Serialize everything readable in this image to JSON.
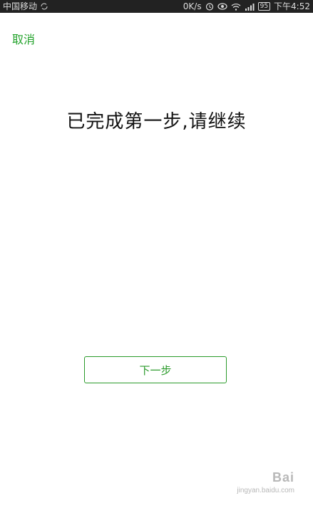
{
  "status_bar": {
    "carrier": "中国移动",
    "network_speed": "0K/s",
    "battery": "95",
    "time": "下午4:52",
    "icons": [
      "alarm-icon",
      "eye-icon",
      "wifi-icon",
      "signal-icon",
      "battery-icon"
    ]
  },
  "header": {
    "cancel_label": "取消"
  },
  "main": {
    "message": "已完成第一步,请继续"
  },
  "actions": {
    "next_label": "下一步"
  },
  "watermark": {
    "brand": "Bai",
    "site": "jingyan.baidu.com"
  },
  "colors": {
    "accent": "#2a9a2a",
    "status_bar_bg": "#222222",
    "text": "#111111"
  }
}
